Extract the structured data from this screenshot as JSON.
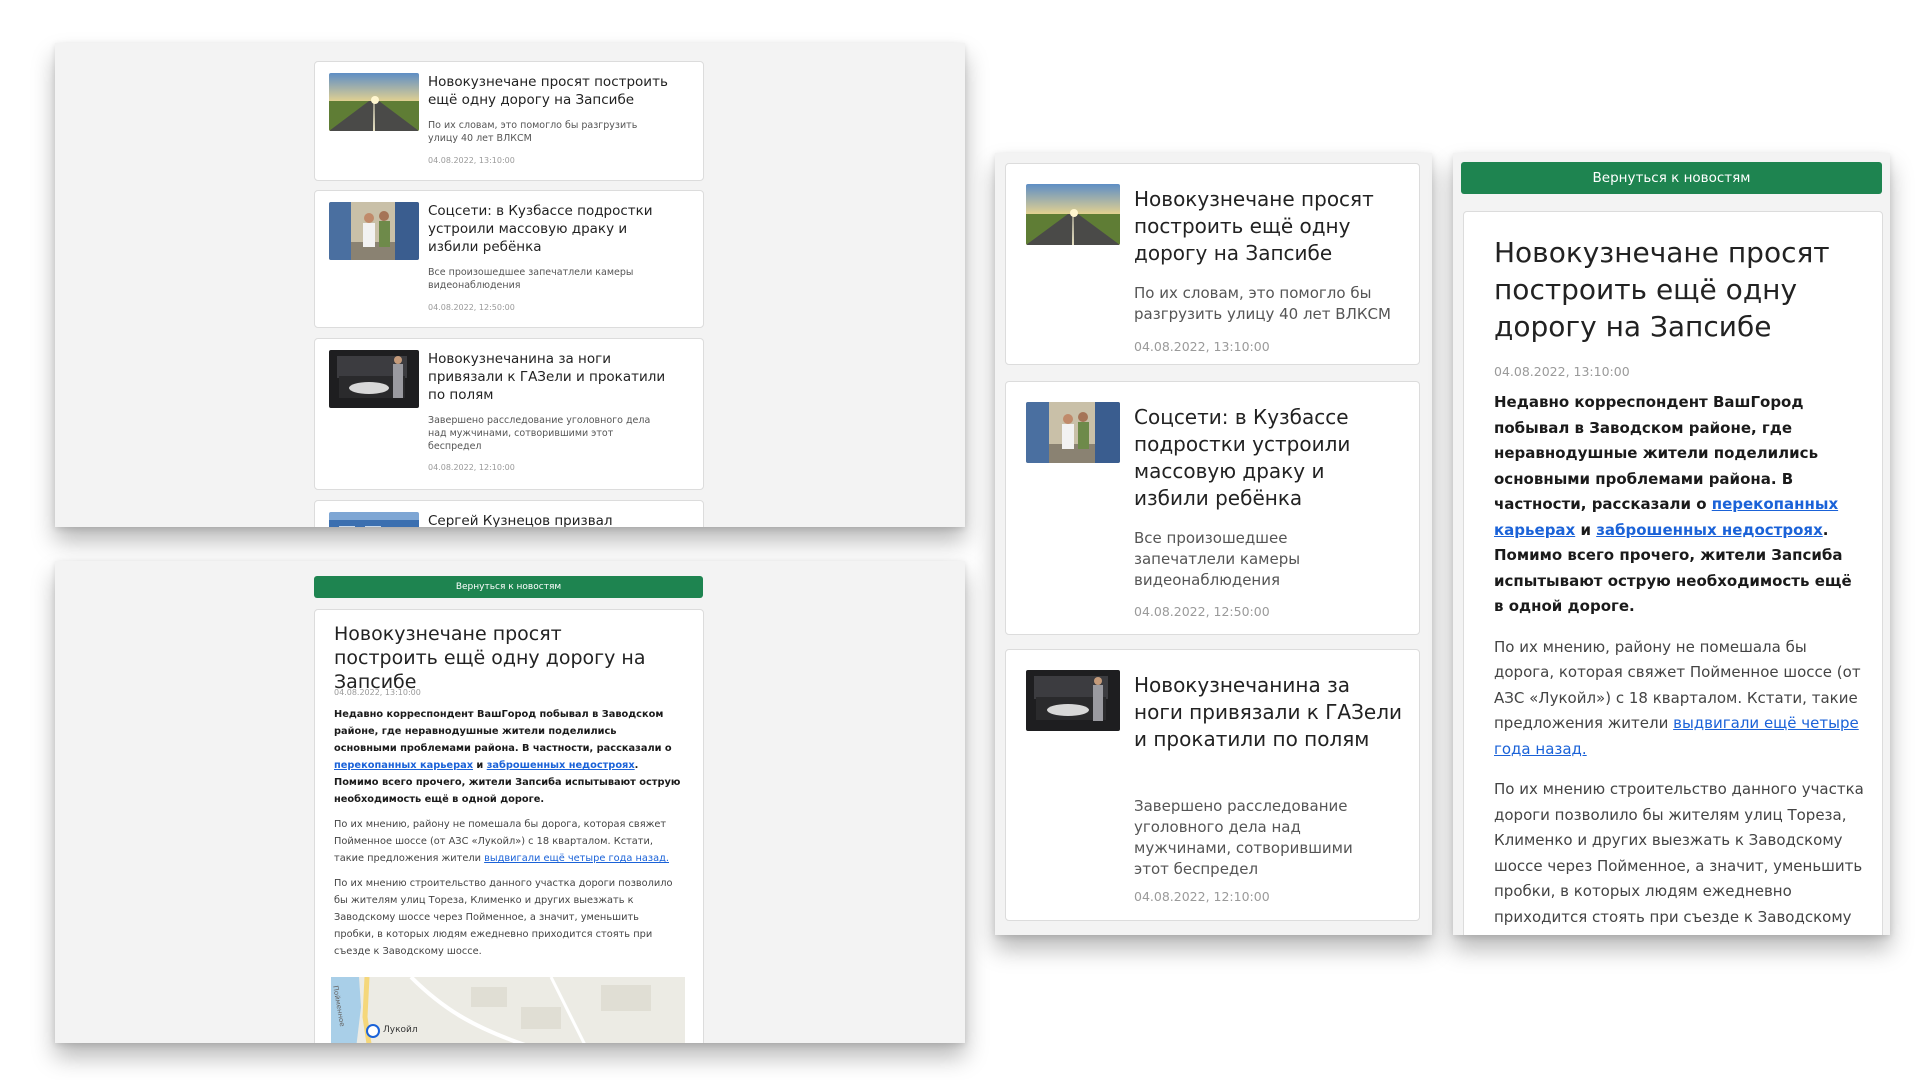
{
  "news_list": {
    "items": [
      {
        "title": "Новокузнечане просят построить ещё одну дорогу на Запсибе",
        "summary": "По их словам, это помогло бы разгрузить улицу 40 лет ВЛКСМ",
        "date": "04.08.2022, 13:10:00",
        "image": "road-photo"
      },
      {
        "title": "Соцсети: в Кузбассе подростки устроили массовую драку и избили ребёнка",
        "summary": "Все произошедшее запечатлели камеры видеонаблюдения",
        "date": "04.08.2022, 12:50:00",
        "image": "fight-photo"
      },
      {
        "title": "Новокузнечанина за ноги привязали к ГАЗели и прокатили по полям",
        "summary": "Завершено расследование уголовного дела над мужчинами, сотворившими этот беспредел",
        "date": "04.08.2022, 12:10:00",
        "image": "car-trunk-photo"
      },
      {
        "title": "Сергей Кузнецов призвал",
        "summary": "",
        "date": "",
        "image": "building-photo"
      }
    ]
  },
  "article": {
    "back_label": "Вернуться к новостям",
    "title": "Новокузнечане просят построить ещё одну дорогу на Запсибе",
    "date": "04.08.2022, 13:10:00",
    "lead_1": "Недавно корреспондент ВашГород побывал в Заводском районе, где неравнодушные жители поделились основными проблемами района. В частности, рассказали о ",
    "lead_link_1": "перекопанных карьерах",
    "lead_2": " и ",
    "lead_link_2": "заброшенных недостроях",
    "lead_3": ". Помимо всего прочего, жители Запсиба испытывают острую необходимость ещё в одной дороге.",
    "p2_text": "По их мнению, району не помешала бы дорога, которая свяжет Пойменное шоссе (от АЗС «Лукойл») с 18 кварталом. Кстати, такие предложения жители ",
    "p2_link": "выдвигали ещё четыре года назад.",
    "p3_text": "По их мнению строительство данного участка дороги позволило бы жителям улиц Тореза, Клименко и других выезжать к Заводскому шоссе через Пойменное, а значит, уменьшить пробки, в которых людям ежедневно приходится стоять при съезде к Заводскому шоссе.",
    "map_label": "Лукойл",
    "map_road_label": "Пойменное"
  },
  "colors": {
    "accent": "#1e8450",
    "link": "#1a62d8",
    "page_bg": "#f3f3f3"
  }
}
